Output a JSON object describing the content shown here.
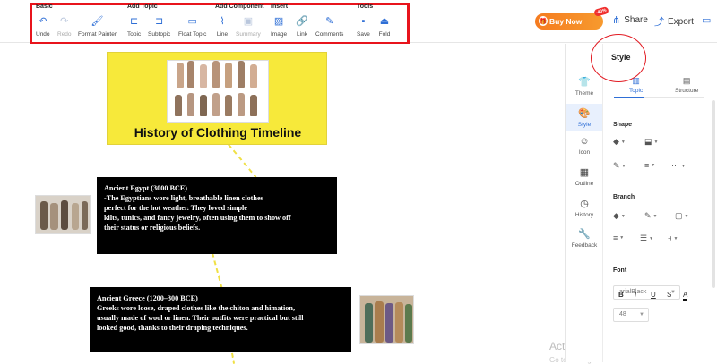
{
  "toolbar": {
    "groups": [
      {
        "title": "Basic",
        "buttons": [
          {
            "label": "Undo",
            "icon": "undo-icon",
            "enabled": true
          },
          {
            "label": "Redo",
            "icon": "redo-icon",
            "enabled": false
          },
          {
            "label": "Format Painter",
            "icon": "format-painter-icon",
            "enabled": true
          }
        ]
      },
      {
        "title": "Add Topic",
        "buttons": [
          {
            "label": "Topic",
            "icon": "topic-icon",
            "enabled": true
          },
          {
            "label": "Subtopic",
            "icon": "subtopic-icon",
            "enabled": true
          },
          {
            "label": "Float Topic",
            "icon": "float-topic-icon",
            "enabled": true
          }
        ]
      },
      {
        "title": "Add Component",
        "buttons": [
          {
            "label": "Line",
            "icon": "line-icon",
            "enabled": true
          },
          {
            "label": "Summary",
            "icon": "summary-icon",
            "enabled": false
          }
        ]
      },
      {
        "title": "Insert",
        "buttons": [
          {
            "label": "Image",
            "icon": "image-icon",
            "enabled": true
          },
          {
            "label": "Link",
            "icon": "link-icon",
            "enabled": true
          },
          {
            "label": "Comments",
            "icon": "comments-icon",
            "enabled": true
          }
        ]
      },
      {
        "title": "Tools",
        "buttons": [
          {
            "label": "Save",
            "icon": "save-icon",
            "enabled": true
          },
          {
            "label": "Fold",
            "icon": "fold-icon",
            "enabled": true
          }
        ]
      }
    ],
    "buy_now": "Buy Now",
    "buy_badge": "-40%",
    "share": "Share",
    "export": "Export"
  },
  "mindmap": {
    "root_title": "History of Clothing Timeline",
    "nodes": [
      {
        "title": "Ancient Egypt (3000 BCE)",
        "text": "-The Egyptians wore light, breathable linen clothes\nperfect for the hot weather. They loved simple\nkilts, tunics, and fancy jewelry, often using them to show off\ntheir status or religious beliefs."
      },
      {
        "title": "Ancient Greece (1200–300 BCE)",
        "text": "Greeks wore loose, draped clothes like the chiton and himation,\nusually made of wool or linen. Their outfits were practical but still\n looked good, thanks to their draping techniques."
      }
    ]
  },
  "sidebar": {
    "items": [
      {
        "label": "Theme",
        "icon": "tshirt-icon",
        "active": false
      },
      {
        "label": "Style",
        "icon": "palette-icon",
        "active": true
      },
      {
        "label": "Icon",
        "icon": "smiley-icon",
        "active": false
      },
      {
        "label": "Outline",
        "icon": "outline-icon",
        "active": false
      },
      {
        "label": "History",
        "icon": "clock-icon",
        "active": false
      },
      {
        "label": "Feedback",
        "icon": "wrench-icon",
        "active": false
      }
    ]
  },
  "panel": {
    "title": "Style",
    "tabs": [
      {
        "label": "Topic",
        "active": true
      },
      {
        "label": "Structure",
        "active": false
      }
    ],
    "section_shape": "Shape",
    "section_branch": "Branch",
    "section_font": "Font",
    "font_family": "arialBlack",
    "font_size": "48"
  },
  "watermark": {
    "line1": "Activate Windows",
    "line2": "Go to Settings to activate Windows."
  },
  "colors": {
    "accent": "#2f6fd6",
    "root_fill": "#f7e93a",
    "highlight_red": "#e8141c",
    "buy_orange": "#f57b1f"
  }
}
